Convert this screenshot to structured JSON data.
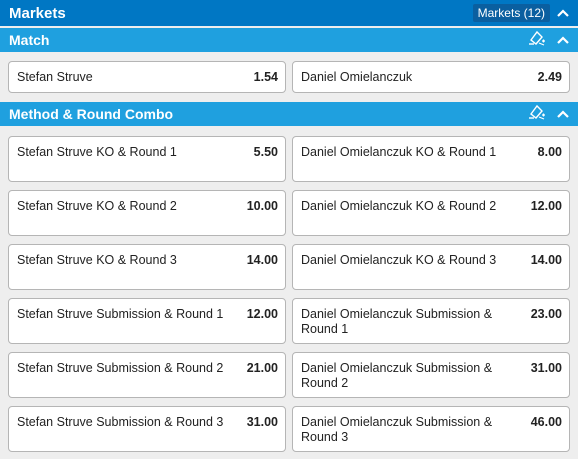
{
  "header": {
    "title": "Markets",
    "markets_count": "Markets (12)"
  },
  "sections": {
    "match": {
      "title": "Match",
      "selections": [
        {
          "name": "Stefan Struve",
          "odds": "1.54"
        },
        {
          "name": "Daniel Omielanczuk",
          "odds": "2.49"
        }
      ]
    },
    "combo": {
      "title": "Method & Round Combo",
      "selections": [
        {
          "name": "Stefan Struve KO & Round 1",
          "odds": "5.50"
        },
        {
          "name": "Daniel Omielanczuk KO & Round 1",
          "odds": "8.00"
        },
        {
          "name": "Stefan Struve KO & Round 2",
          "odds": "10.00"
        },
        {
          "name": "Daniel Omielanczuk KO & Round 2",
          "odds": "12.00"
        },
        {
          "name": "Stefan Struve KO & Round 3",
          "odds": "14.00"
        },
        {
          "name": "Daniel Omielanczuk KO & Round 3",
          "odds": "14.00"
        },
        {
          "name": "Stefan Struve Submission & Round 1",
          "odds": "12.00"
        },
        {
          "name": "Daniel Omielanczuk Submission & Round 1",
          "odds": "23.00"
        },
        {
          "name": "Stefan Struve Submission & Round 2",
          "odds": "21.00"
        },
        {
          "name": "Daniel Omielanczuk Submission & Round 2",
          "odds": "31.00"
        },
        {
          "name": "Stefan Struve Submission & Round 3",
          "odds": "31.00"
        },
        {
          "name": "Daniel Omielanczuk Submission & Round 3",
          "odds": "46.00"
        }
      ]
    }
  },
  "icons": {
    "collapse": "chevron-up-icon",
    "bet_builder": "bet-builder-icon"
  },
  "colors": {
    "header_bg": "#0077c4",
    "section_bg": "#1fa0df",
    "page_bg": "#eeeeee"
  }
}
